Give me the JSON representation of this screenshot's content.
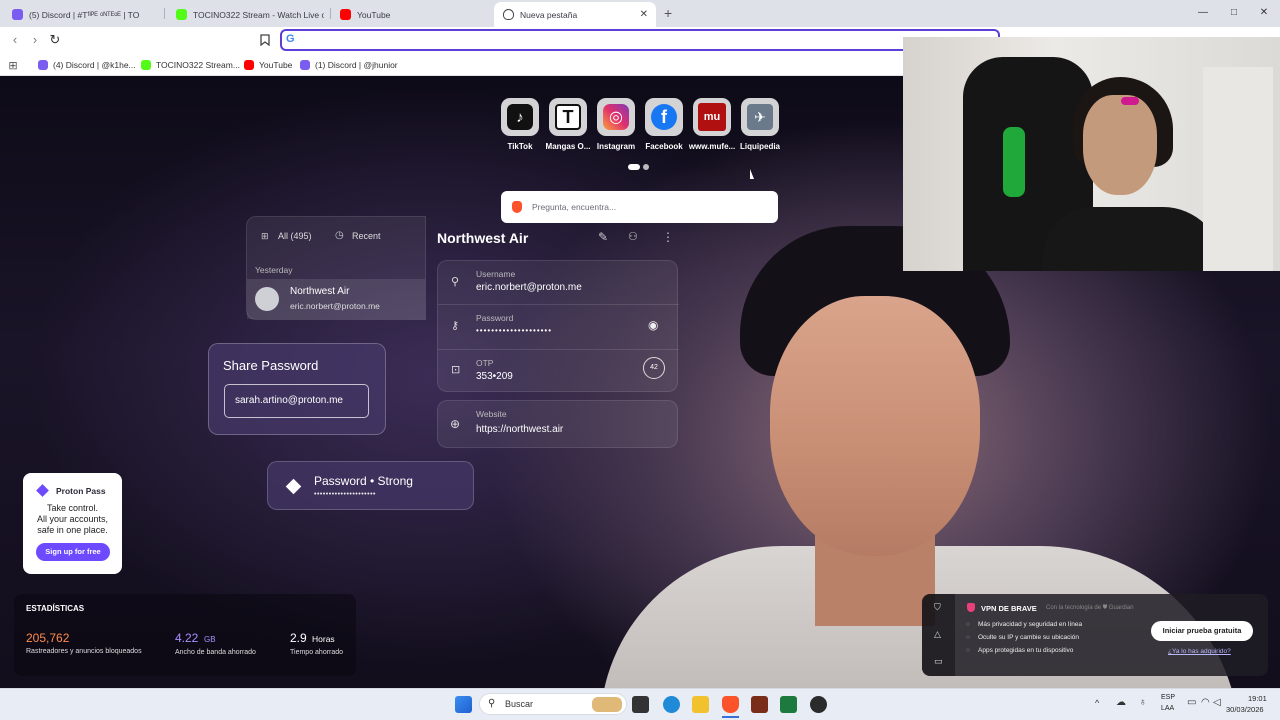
{
  "tabs": [
    {
      "title": "(5) Discord | #Tᶠᴵᴾᴱ ᵒᴺᵀᴱᵒᴱ | TO",
      "color": "#7b5cf0"
    },
    {
      "title": "TOCINO322 Stream - Watch Live on K",
      "color": "#53fc18"
    },
    {
      "title": "YouTube",
      "color": "#ff0000"
    },
    {
      "title": "Nueva pestaña",
      "color": "#3a3a46"
    }
  ],
  "new_tab_symbol": "+",
  "window_controls": {
    "minimize": "—",
    "maximize": "□",
    "close": "✕"
  },
  "toolbar": {
    "back": "‹",
    "forward": "›",
    "reload": "↻"
  },
  "bookmarks": [
    {
      "label": "(4) Discord | @k1he...",
      "color": "#7b5cf0"
    },
    {
      "label": "TOCINO322 Stream...",
      "color": "#53fc18"
    },
    {
      "label": "YouTube",
      "color": "#ff0000"
    },
    {
      "label": "(1) Discord | @jhunior",
      "color": "#7b5cf0"
    }
  ],
  "shortcuts": [
    {
      "label": "TikTok",
      "glyph": "♪",
      "bg": "#111"
    },
    {
      "label": "Mangas O...",
      "glyph": "T",
      "bg": "#fff"
    },
    {
      "label": "Instagram",
      "glyph": "◎",
      "bg": "#e1306c"
    },
    {
      "label": "Facebook",
      "glyph": "f",
      "bg": "#1877f2"
    },
    {
      "label": "www.mufe...",
      "glyph": "mu",
      "bg": "#b01010"
    },
    {
      "label": "Liquipedia",
      "glyph": "✈",
      "bg": "#6b7a8a"
    }
  ],
  "search": {
    "placeholder": "Pregunta, encuentra..."
  },
  "pass": {
    "all": "All (495)",
    "recent": "Recent",
    "yesterday": "Yesterday",
    "item_title": "Northwest Air",
    "item_email": "eric.norbert@proton.me",
    "detail_title": "Northwest Air",
    "username_label": "Username",
    "username": "eric.norbert@proton.me",
    "password_label": "Password",
    "password": "••••••••••••••••••••",
    "otp_label": "OTP",
    "otp": "353•209",
    "otp_timer": "42",
    "website_label": "Website",
    "website": "https://northwest.air",
    "share_title": "Share Password",
    "share_email": "sarah.artino@proton.me",
    "strong_label": "Password • Strong",
    "strong_dots": "•••••••••••••••••••••"
  },
  "proton_ad": {
    "brand": "Proton Pass",
    "line1": "Take control.",
    "line2": "All your accounts,",
    "line3": "safe in one place.",
    "cta": "Sign up for free"
  },
  "stats": {
    "title": "ESTADÍSTICAS",
    "items": [
      {
        "value": "205,762",
        "unit": "",
        "label": "Rastreadores y anuncios bloqueados",
        "color": "#ff8a4c"
      },
      {
        "value": "4.22",
        "unit": "GB",
        "label": "Ancho de banda ahorrado",
        "color": "#a690ff"
      },
      {
        "value": "2.9",
        "unit": "Horas",
        "label": "Tiempo ahorrado",
        "color": "#ffffff"
      }
    ]
  },
  "vpn": {
    "title": "VPN DE BRAVE",
    "powered": "Con la tecnología de ⛊ Guardian",
    "features": [
      "Más privacidad y seguridad en línea",
      "Oculte su IP y cambie su ubicación",
      "Apps protegidas en tu dispositivo"
    ],
    "cta": "Iniciar prueba gratuita",
    "link": "¿Ya lo has adquirido?"
  },
  "taskbar": {
    "search": "Buscar",
    "lang1": "ESP",
    "lang2": "LAA",
    "time": "19:01",
    "date": "30/03/2026"
  },
  "colors": {
    "accent": "#5b3fd6",
    "proton": "#6d4aff",
    "brave": "#fb542b"
  }
}
